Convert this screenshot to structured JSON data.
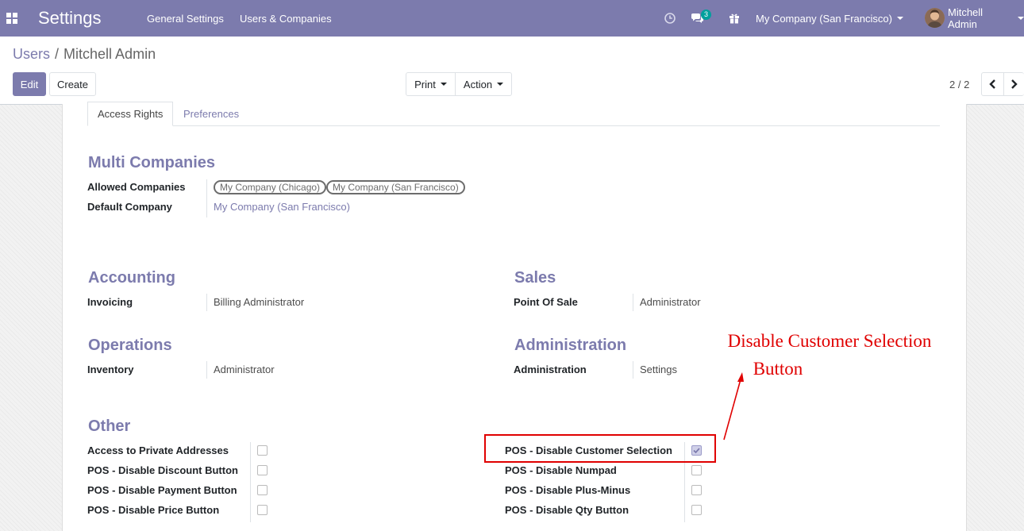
{
  "navbar": {
    "app_title": "Settings",
    "menu": [
      "General Settings",
      "Users & Companies"
    ],
    "messages_count": "3",
    "company": "My Company (San Francisco)",
    "user": "Mitchell Admin"
  },
  "breadcrumb": {
    "parent": "Users",
    "separator": "/",
    "current": "Mitchell Admin"
  },
  "toolbar": {
    "edit_label": "Edit",
    "create_label": "Create",
    "print_label": "Print",
    "action_label": "Action",
    "pager": "2 / 2"
  },
  "tabs": {
    "access_rights": "Access Rights",
    "preferences": "Preferences"
  },
  "multi_companies": {
    "title": "Multi Companies",
    "allowed_label": "Allowed Companies",
    "allowed": [
      "My Company (Chicago)",
      "My Company (San Francisco)"
    ],
    "default_label": "Default Company",
    "default_value": "My Company (San Francisco)"
  },
  "accounting": {
    "title": "Accounting",
    "label": "Invoicing",
    "value": "Billing Administrator"
  },
  "sales": {
    "title": "Sales",
    "label": "Point Of Sale",
    "value": "Administrator"
  },
  "operations": {
    "title": "Operations",
    "label": "Inventory",
    "value": "Administrator"
  },
  "administration": {
    "title": "Administration",
    "label": "Administration",
    "value": "Settings"
  },
  "other": {
    "title": "Other",
    "left": [
      {
        "label": "Access to Private Addresses",
        "checked": false
      },
      {
        "label": "POS - Disable Discount Button",
        "checked": false
      },
      {
        "label": "POS - Disable Payment Button",
        "checked": false
      },
      {
        "label": "POS - Disable Price Button",
        "checked": false
      }
    ],
    "right": [
      {
        "label": "POS - Disable Customer Selection",
        "checked": true
      },
      {
        "label": "POS - Disable Numpad",
        "checked": false
      },
      {
        "label": "POS - Disable Plus-Minus",
        "checked": false
      },
      {
        "label": "POS - Disable Qty Button",
        "checked": false
      }
    ]
  },
  "annotation": {
    "line1": "Disable Customer Selection",
    "line2": "Button",
    "color": "#e00000"
  },
  "colors": {
    "brand": "#7c7bad",
    "badge": "#00a09d"
  }
}
